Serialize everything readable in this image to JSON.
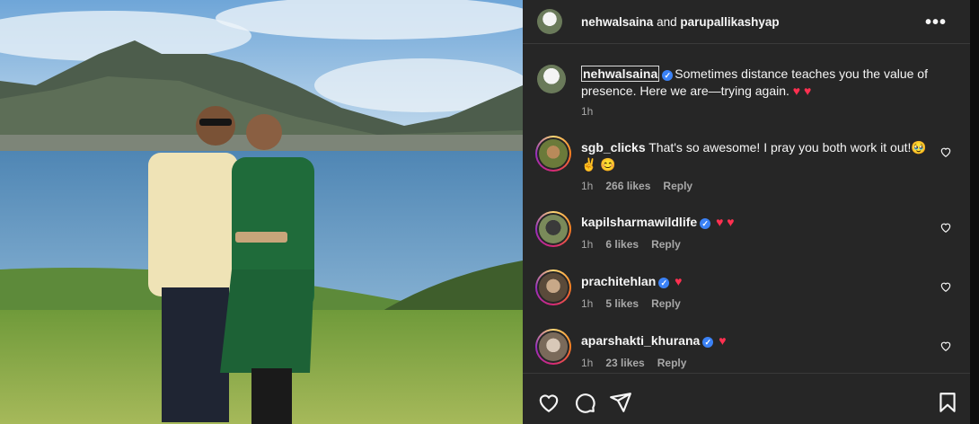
{
  "header": {
    "user1": "nehwalsaina",
    "and": "and",
    "user2": "parupallikashyap",
    "more_label": "•••"
  },
  "caption": {
    "username": "nehwalsaina",
    "text": "Sometimes distance teaches you the value of presence. Here we are—trying again.",
    "emoji": "♥ ♥",
    "time": "1h"
  },
  "comments": [
    {
      "username": "sgb_clicks",
      "verified": false,
      "text": "That's so awesome! I pray you both work it out!🥹 ✌️ 😊",
      "time": "1h",
      "likes": "266 likes",
      "reply": "Reply"
    },
    {
      "username": "kapilsharmawildlife",
      "verified": true,
      "text": "♥ ♥",
      "time": "1h",
      "likes": "6 likes",
      "reply": "Reply"
    },
    {
      "username": "prachitehlan",
      "verified": true,
      "text": "♥",
      "time": "1h",
      "likes": "5 likes",
      "reply": "Reply"
    },
    {
      "username": "aparshakti_khurana",
      "verified": true,
      "text": "♥",
      "time": "1h",
      "likes": "23 likes",
      "reply": "Reply"
    }
  ],
  "icons": {
    "more": "more-options-icon",
    "like": "heart-icon",
    "comment": "comment-icon",
    "share": "share-icon",
    "save": "bookmark-icon",
    "verified": "verified-badge-icon"
  },
  "colors": {
    "panel_bg": "#262626",
    "verified": "#3b82f6",
    "heart": "#ff3050",
    "muted": "#a8a8a8"
  }
}
